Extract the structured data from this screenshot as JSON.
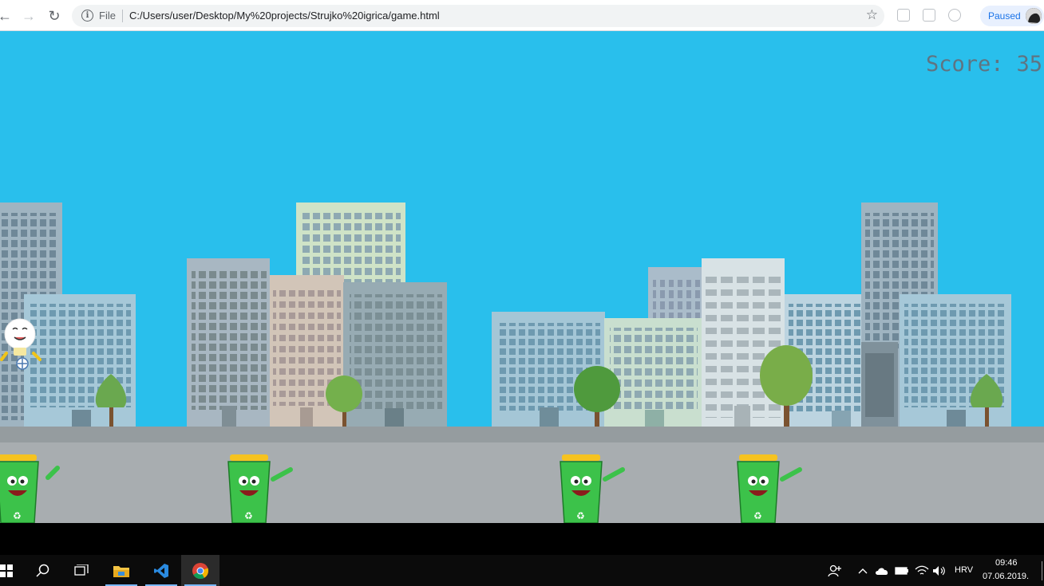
{
  "browser": {
    "file_label": "File",
    "url": "C:/Users/user/Desktop/My%20projects/Strujko%20igrica/game.html",
    "paused_label": "Paused"
  },
  "game": {
    "score_label": "Score:",
    "score_value": "35"
  },
  "taskbar": {
    "language": "HRV",
    "time": "09:46",
    "date": "07.06.2019."
  },
  "colors": {
    "sky": "#29bfec",
    "road": "#a8adb0",
    "bin_green": "#3cc24a",
    "bin_lid": "#f6c320"
  }
}
